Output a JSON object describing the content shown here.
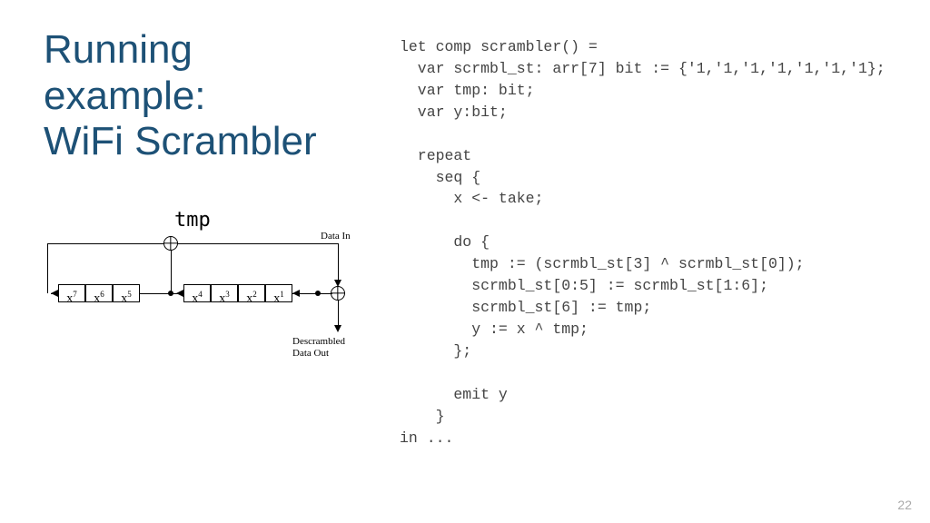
{
  "title_l1": "Running",
  "title_l2": "example:",
  "title_l3": "WiFi Scrambler",
  "code": "let comp scrambler() =\n  var scrmbl_st: arr[7] bit := {'1,'1,'1,'1,'1,'1,'1};\n  var tmp: bit;\n  var y:bit;\n\n  repeat\n    seq {\n      x <- take;\n\n      do {\n        tmp := (scrmbl_st[3] ^ scrmbl_st[0]);\n        scrmbl_st[0:5] := scrmbl_st[1:6];\n        scrmbl_st[6] := tmp;\n        y := x ^ tmp;\n      };\n\n      emit y\n    }\nin ...",
  "tmp_label": "tmp",
  "data_in_label": "Data In",
  "data_out_label_l1": "Descrambled",
  "data_out_label_l2": "Data Out",
  "registers": [
    "7",
    "6",
    "5",
    "4",
    "3",
    "2",
    "1"
  ],
  "page_num": "22"
}
